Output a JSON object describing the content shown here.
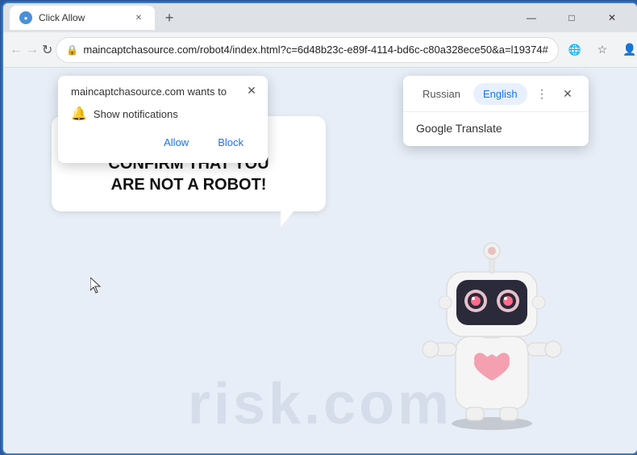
{
  "browser": {
    "tab": {
      "title": "Click Allow",
      "favicon": "●"
    },
    "new_tab_icon": "+",
    "window_controls": {
      "minimize": "—",
      "maximize": "□",
      "close": "✕"
    },
    "nav": {
      "back": "←",
      "forward": "→",
      "reload": "↻",
      "url": "maincaptchasource.com/robot4/index.html?c=6d48b23c-e89f-4114-bd6c-c80a328ece50&a=l19374#",
      "lock_icon": "🔒"
    }
  },
  "notification_popup": {
    "title": "maincaptchasource.com wants to",
    "notification_label": "Show notifications",
    "allow_button": "Allow",
    "block_button": "Block",
    "close_icon": "✕",
    "bell_icon": "🔔"
  },
  "translate_popup": {
    "tab_russian": "Russian",
    "tab_english": "English",
    "more_icon": "⋮",
    "close_icon": "✕",
    "service": "Google Translate"
  },
  "page": {
    "main_text_line1": "CLICK «ALLOW» TO CONFIRM THAT YOU",
    "main_text_line2": "ARE NOT A ROBOT!",
    "watermark": "risk.com"
  },
  "colors": {
    "accent_blue": "#1a73e8",
    "page_bg": "#d8e3f0",
    "bubble_white": "#ffffff",
    "tab_active": "#e8f0fe"
  }
}
